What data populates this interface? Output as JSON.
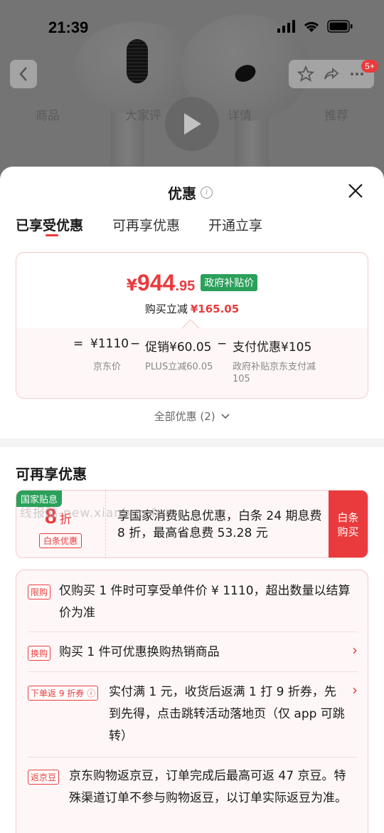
{
  "status_bar": {
    "time": "21:39"
  },
  "nav": {
    "badge": "5+"
  },
  "bg_tabs": [
    "商品",
    "大家评",
    "详情",
    "推荐"
  ],
  "sheet": {
    "title": "优惠",
    "tabs": [
      "已享受优惠",
      "可再享优惠",
      "开通立享"
    ]
  },
  "price": {
    "yen": "¥",
    "int": "944",
    "dec": ".95",
    "gov_tag": "政府补贴价",
    "reduce_label": "购买立减",
    "reduce_amount": "¥165.05",
    "eq": "=",
    "base": "¥1110",
    "base_label": "京东价",
    "minus1": "−",
    "promo": "促销¥60.05",
    "promo_label": "PLUS立减60.05",
    "minus2": "−",
    "pay": "支付优惠¥105",
    "pay_label": "政府补贴京东支付减105"
  },
  "all_offers": "全部优惠 (2)",
  "section_title": "可再享优惠",
  "coupon": {
    "flag": "国家贴息",
    "num": "8",
    "unit": "折",
    "tag": "白条优惠",
    "text": "享国家消费贴息优惠，白条 24 期息费 8 折，最高省息费 53.28 元",
    "button": "白条购买"
  },
  "watermark": "线报酷-new.xianbao.fun",
  "rules": [
    {
      "tag": "限购",
      "text": "仅购买 1 件时可享受单件价 ¥ 1110，超出数量以结算价为准"
    },
    {
      "tag": "换购",
      "text": "购买 1 件可优惠换购热销商品"
    },
    {
      "tag": "下单返 9 折券",
      "text": "实付满 1 元，收货后返满 1 打 9 折券，先到先得，点击跳转活动落地页（仅 app 可跳转）"
    },
    {
      "tag": "返京豆",
      "text": "京东购物返京豆，订单完成后最高可返 47 京豆。特殊渠道订单不参与购物返豆，以订单实际返豆为准。"
    }
  ],
  "colors": {
    "accent": "#e93b3d",
    "green": "#2aa05b"
  }
}
